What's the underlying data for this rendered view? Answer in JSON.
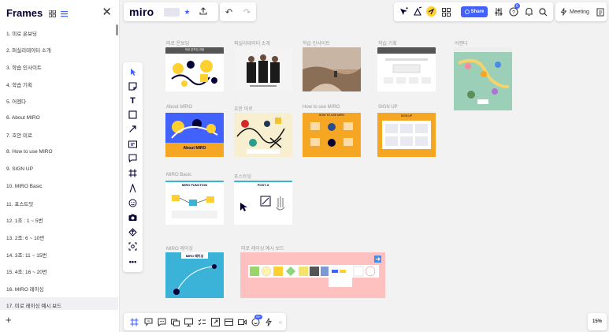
{
  "frames_panel": {
    "title": "Frames",
    "items": [
      "1.  미로 온보딩",
      "2.  퍼실리테이터 소개",
      "3.  학습 인사이트",
      "4.  학습 기획",
      "5.  어젠다",
      "6.  About MIRO",
      "7.  호안 미로",
      "8.  How to use MIRO",
      "9.  SIGN UP",
      "10. MIRO Basic",
      "11. 포스트잇",
      "12. 1조 : 1 ~ 5번",
      "13. 2조: 6 ~ 10번",
      "14. 3조: 11 ~ 15번",
      "15. 4조: 16 ~ 20번",
      "16. MIRO 레이싱",
      "17. 미로 레이싱 예시 보드"
    ]
  },
  "topbar": {
    "logo": "miro",
    "share_label": "Share",
    "meeting_label": "Meeting",
    "notification_count": "6"
  },
  "bottombar": {
    "reactions_count": "99+"
  },
  "zoom": "15%",
  "canvas": {
    "frame_labels": {
      "onboarding": "미로 온보딩",
      "facilitator": "퍼실리테이터 소개",
      "insight": "학습 인사이트",
      "plan": "학습 기획",
      "agenda": "어젠다",
      "about": "About MIRO",
      "joan": "호안 미로",
      "howto": "How to use MIRO",
      "signup": "SIGN UP",
      "basic": "MIRO Basic",
      "postit": "포스트잇",
      "racing": "MIRO 레이싱",
      "racing_example": "미로 레이싱 예시 보드"
    },
    "frame_inner_text": {
      "onboarding": "미로 온보딩 과정",
      "about": "About MIRO",
      "howto": "HOW TO USE MIRO",
      "signup": "SIGN UP",
      "basic": "MIRO FUNCTION",
      "postit": "POST-it",
      "racing": "MIRO 레이싱"
    }
  },
  "colors": {
    "accent": "#4262ff",
    "brand_yellow": "#ffd02f",
    "orange": "#f5a623",
    "teal": "#3bb3d8",
    "pink": "#ffc0c0"
  }
}
